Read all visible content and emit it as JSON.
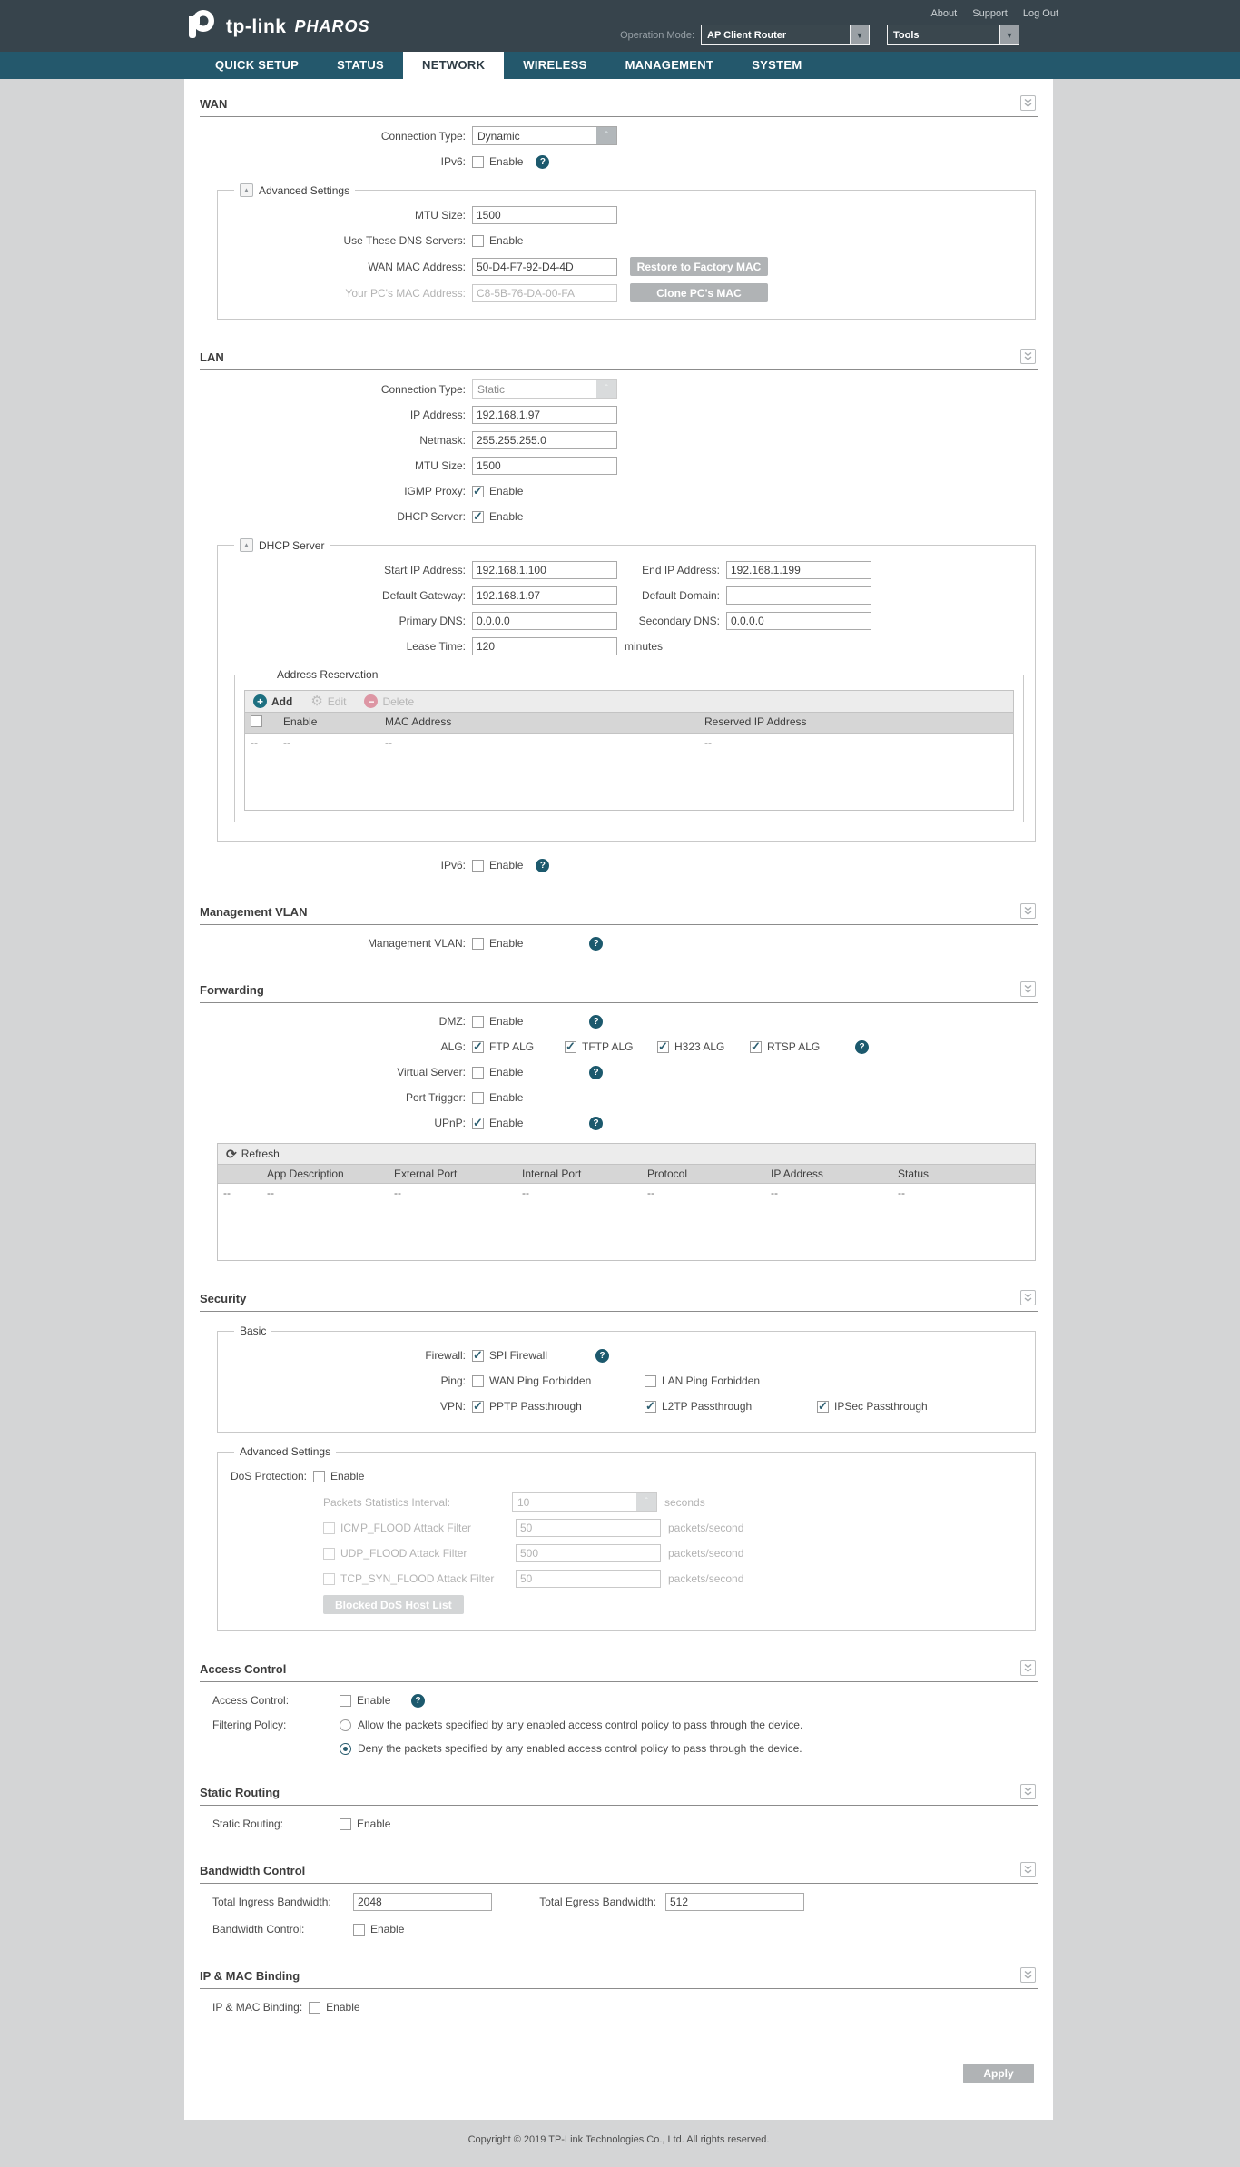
{
  "header": {
    "links": {
      "about": "About",
      "support": "Support",
      "logout": "Log Out"
    },
    "brand": {
      "name": "tp-link",
      "product": "PHAROS"
    },
    "operation_mode_label": "Operation Mode:",
    "operation_mode_value": "AP Client Router",
    "tools_value": "Tools"
  },
  "nav": {
    "tabs": [
      {
        "label": "QUICK SETUP"
      },
      {
        "label": "STATUS"
      },
      {
        "label": "NETWORK"
      },
      {
        "label": "WIRELESS"
      },
      {
        "label": "MANAGEMENT"
      },
      {
        "label": "SYSTEM"
      }
    ]
  },
  "wan": {
    "title": "WAN",
    "connection_type_label": "Connection Type:",
    "connection_type_value": "Dynamic",
    "ipv6_label": "IPv6:",
    "enable": "Enable",
    "advanced_legend": "Advanced Settings",
    "mtu_label": "MTU Size:",
    "mtu_value": "1500",
    "dns_label": "Use These DNS Servers:",
    "wan_mac_label": "WAN MAC Address:",
    "wan_mac_value": "50-D4-F7-92-D4-4D",
    "restore_button": "Restore to Factory MAC",
    "pc_mac_label": "Your PC's MAC Address:",
    "pc_mac_value": "C8-5B-76-DA-00-FA",
    "clone_button": "Clone PC's MAC"
  },
  "lan": {
    "title": "LAN",
    "connection_type_label": "Connection Type:",
    "connection_type_value": "Static",
    "ip_label": "IP Address:",
    "ip_value": "192.168.1.97",
    "netmask_label": "Netmask:",
    "netmask_value": "255.255.255.0",
    "mtu_label": "MTU Size:",
    "mtu_value": "1500",
    "igmp_label": "IGMP Proxy:",
    "dhcp_label": "DHCP Server:",
    "enable": "Enable",
    "ipv6_label": "IPv6:",
    "dhcp": {
      "legend": "DHCP Server",
      "start_label": "Start IP Address:",
      "start_value": "192.168.1.100",
      "end_label": "End IP Address:",
      "end_value": "192.168.1.199",
      "gateway_label": "Default Gateway:",
      "gateway_value": "192.168.1.97",
      "domain_label": "Default Domain:",
      "domain_value": "",
      "pdns_label": "Primary DNS:",
      "pdns_value": "0.0.0.0",
      "sdns_label": "Secondary DNS:",
      "sdns_value": "0.0.0.0",
      "lease_label": "Lease Time:",
      "lease_value": "120",
      "lease_unit": "minutes"
    },
    "reservation": {
      "legend": "Address Reservation",
      "add": "Add",
      "edit": "Edit",
      "delete": "Delete",
      "headers": {
        "enable": "Enable",
        "mac": "MAC Address",
        "reserved": "Reserved IP Address"
      },
      "row": {
        "c0": "--",
        "c1": "--",
        "c2": "--",
        "c3": "--"
      }
    }
  },
  "mgmt_vlan": {
    "title": "Management VLAN",
    "label": "Management VLAN:",
    "enable": "Enable"
  },
  "forwarding": {
    "title": "Forwarding",
    "dmz_label": "DMZ:",
    "enable": "Enable",
    "alg_label": "ALG:",
    "alg_items": [
      {
        "label": "FTP ALG"
      },
      {
        "label": "TFTP ALG"
      },
      {
        "label": "H323 ALG"
      },
      {
        "label": "RTSP ALG"
      }
    ],
    "virtual_label": "Virtual Server:",
    "port_trigger_label": "Port Trigger:",
    "upnp_label": "UPnP:",
    "table": {
      "refresh": "Refresh",
      "headers": [
        "",
        "App Description",
        "External Port",
        "Internal Port",
        "Protocol",
        "IP Address",
        "Status"
      ],
      "row": [
        "--",
        "--",
        "--",
        "--",
        "--",
        "--",
        "--"
      ]
    }
  },
  "security": {
    "title": "Security",
    "basic": {
      "legend": "Basic",
      "firewall_label": "Firewall:",
      "spi": "SPI Firewall",
      "ping_label": "Ping:",
      "wan_ping": "WAN Ping Forbidden",
      "lan_ping": "LAN Ping Forbidden",
      "vpn_label": "VPN:",
      "pptp": "PPTP Passthrough",
      "l2tp": "L2TP Passthrough",
      "ipsec": "IPSec Passthrough"
    },
    "advanced": {
      "legend": "Advanced Settings",
      "dos_label": "DoS Protection:",
      "enable": "Enable",
      "interval_label": "Packets Statistics Interval:",
      "interval_value": "10",
      "interval_unit": "seconds",
      "icmp_label": "ICMP_FLOOD Attack Filter",
      "icmp_value": "50",
      "udp_label": "UDP_FLOOD Attack Filter",
      "udp_value": "500",
      "tcp_label": "TCP_SYN_FLOOD Attack Filter",
      "tcp_value": "50",
      "pps_unit": "packets/second",
      "blocked_button": "Blocked DoS Host List"
    }
  },
  "access_control": {
    "title": "Access Control",
    "label": "Access Control:",
    "enable": "Enable",
    "policy_label": "Filtering Policy:",
    "allow_option": "Allow the packets specified by any enabled access control policy to pass through the device.",
    "deny_option": "Deny the packets specified by any enabled access control policy to pass through the device."
  },
  "static_routing": {
    "title": "Static Routing",
    "label": "Static Routing:",
    "enable": "Enable"
  },
  "bandwidth": {
    "title": "Bandwidth Control",
    "ingress_label": "Total Ingress Bandwidth:",
    "ingress_value": "2048",
    "egress_label": "Total Egress Bandwidth:",
    "egress_value": "512",
    "control_label": "Bandwidth Control:",
    "enable": "Enable"
  },
  "ip_mac": {
    "title": "IP & MAC Binding",
    "label": "IP & MAC Binding:",
    "enable": "Enable"
  },
  "apply_button": "Apply",
  "footer": {
    "copyright": "Copyright © 2019 TP-Link Technologies Co., Ltd. All rights reserved."
  }
}
